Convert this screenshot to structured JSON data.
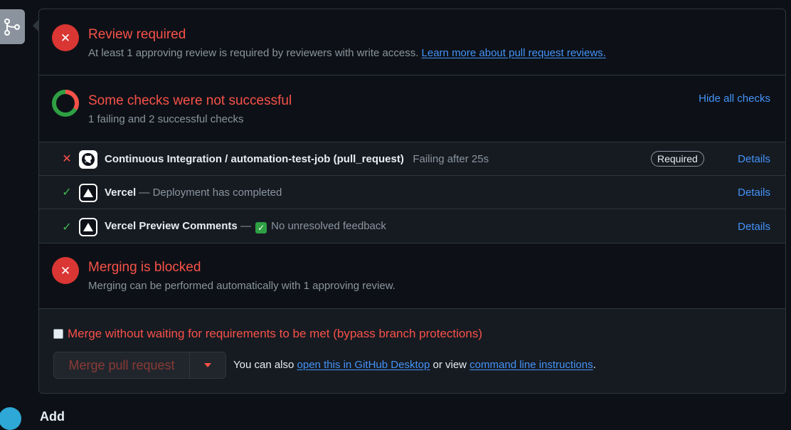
{
  "review": {
    "title": "Review required",
    "subtitle": "At least 1 approving review is required by reviewers with write access.",
    "learn_more": "Learn more about pull request reviews."
  },
  "checks": {
    "title": "Some checks were not successful",
    "subtitle": "1 failing and 2 successful checks",
    "hide_all": "Hide all checks",
    "summary": {
      "failing": 1,
      "successful": 2
    },
    "items": [
      {
        "status": "fail",
        "icon": "github-icon",
        "name": "Continuous Integration / automation-test-job (pull_request)",
        "separator": "",
        "description": "Failing after 25s",
        "badge": "Required",
        "details": "Details"
      },
      {
        "status": "success",
        "icon": "vercel-icon",
        "name": "Vercel",
        "separator": "—",
        "description": "Deployment has completed",
        "details": "Details"
      },
      {
        "status": "success",
        "icon": "vercel-icon",
        "name": "Vercel Preview Comments",
        "separator": "—",
        "description": "No unresolved feedback",
        "details": "Details"
      }
    ]
  },
  "blocked": {
    "title": "Merging is blocked",
    "subtitle": "Merging can be performed automatically with 1 approving review."
  },
  "merge": {
    "bypass_label": "Merge without waiting for requirements to be met (bypass branch protections)",
    "bypass_checked": false,
    "button_label": "Merge pull request",
    "note_prefix": "You can also",
    "desktop_link": "open this in GitHub Desktop",
    "note_middle": "or view",
    "cli_link": "command line instructions",
    "note_suffix": "."
  },
  "footer": {
    "partial_text": "Add"
  },
  "colors": {
    "background": "#0d1117",
    "danger": "#f85149",
    "success": "#3fb950",
    "link": "#4493f8",
    "muted": "#8b949e",
    "border": "#30363d"
  }
}
